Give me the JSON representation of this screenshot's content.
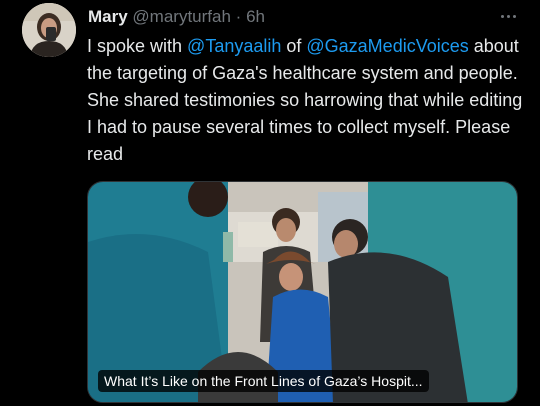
{
  "tweet": {
    "author_name": "Mary",
    "author_handle": "@maryturfah",
    "separator": "·",
    "time": "6h",
    "text_before_mention1": "I spoke with ",
    "mention1": "@Tanyaalih",
    "text_between": " of ",
    "mention2": "@GazaMedicVoices",
    "text_after": " about the targeting of Gaza's healthcare system and people. She shared testimonies so harrowing that while editing I had to pause several times to collect myself. Please read"
  },
  "link_card": {
    "caption": "What It’s Like on the Front Lines of Gaza’s Hospit..."
  },
  "colors": {
    "background": "#000000",
    "text": "#e7e9ea",
    "secondary": "#71767b",
    "mention": "#1d9bf0"
  },
  "icons": {
    "more": "more-horizontal-icon"
  }
}
